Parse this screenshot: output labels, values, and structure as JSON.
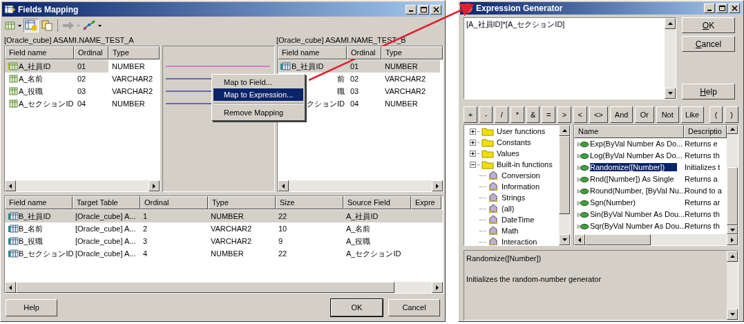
{
  "fields_mapping": {
    "title": "Fields Mapping",
    "source_label": "[Oracle_cube] ASAMI.NAME_TEST_A",
    "target_label": "[Oracle_cube] ASAMI.NAME_TEST_B",
    "source_table": {
      "columns": [
        "Field name",
        "Ordinal",
        "Type"
      ],
      "rows": [
        {
          "name": "A_社員ID",
          "ordinal": "01",
          "type": "NUMBER",
          "selected": true,
          "key": true
        },
        {
          "name": "A_名前",
          "ordinal": "02",
          "type": "VARCHAR2",
          "selected": false,
          "key": false
        },
        {
          "name": "A_役職",
          "ordinal": "03",
          "type": "VARCHAR2",
          "selected": false,
          "key": false
        },
        {
          "name": "A_セクションID",
          "ordinal": "04",
          "type": "NUMBER",
          "selected": false,
          "key": false
        }
      ]
    },
    "mapping_lines": [
      {
        "selected": true
      },
      {
        "selected": false
      },
      {
        "selected": false
      },
      {
        "selected": false
      }
    ],
    "context_menu": {
      "items": [
        {
          "kind": "item",
          "label": "Map to Field...",
          "selected": false
        },
        {
          "kind": "item",
          "label": "Map to Expression...",
          "selected": true
        },
        {
          "kind": "separator"
        },
        {
          "kind": "item",
          "label": "Remove Mapping",
          "selected": false
        }
      ]
    },
    "target_table": {
      "columns": [
        "Field name",
        "Ordinal",
        "Type"
      ],
      "rows": [
        {
          "name": "B_社員ID",
          "ordinal": "01",
          "type": "NUMBER",
          "selected": true,
          "covered": false
        },
        {
          "name": "前",
          "ordinal": "02",
          "type": "VARCHAR2",
          "selected": false,
          "covered": true
        },
        {
          "name": "職",
          "ordinal": "03",
          "type": "VARCHAR2",
          "selected": false,
          "covered": true
        },
        {
          "name": "クションID",
          "ordinal": "04",
          "type": "NUMBER",
          "selected": false,
          "covered": true
        }
      ]
    },
    "mappings_table": {
      "columns": [
        "Field name",
        "Target Table",
        "Ordinal",
        "Type",
        "Size",
        "Source Field",
        "Expre"
      ],
      "rows": [
        {
          "cells": [
            "B_社員ID",
            "[Oracle_cube] A...",
            "1",
            "NUMBER",
            "22",
            "A_社員ID"
          ],
          "selected": true
        },
        {
          "cells": [
            "B_名前",
            "[Oracle_cube] A...",
            "2",
            "VARCHAR2",
            "10",
            "A_名前"
          ],
          "selected": false
        },
        {
          "cells": [
            "B_役職",
            "[Oracle_cube] A...",
            "3",
            "VARCHAR2",
            "9",
            "A_役職"
          ],
          "selected": false
        },
        {
          "cells": [
            "B_セクションID",
            "[Oracle_cube] A...",
            "4",
            "NUMBER",
            "22",
            "A_セクションID"
          ],
          "selected": false
        }
      ]
    },
    "buttons": [
      {
        "label": "Help",
        "default": false
      },
      {
        "label": "OK",
        "default": true
      },
      {
        "label": "Cancel",
        "default": false
      }
    ]
  },
  "expression_generator": {
    "title": "Expression Generator",
    "expression": "[A_社員ID]*[A_セクションID]",
    "buttons": [
      {
        "hotkey": "O",
        "rest": "K"
      },
      {
        "hotkey": "C",
        "rest": "ancel"
      },
      {
        "hotkey": "H",
        "rest": "elp"
      }
    ],
    "operators": [
      "+",
      "-",
      "/",
      "*",
      "&",
      "=",
      ">",
      "<",
      "<>",
      "And",
      "Or",
      "Not",
      "Like",
      "(",
      ")"
    ],
    "tree": [
      {
        "label": "User functions",
        "expanded": false
      },
      {
        "label": "Constants",
        "expanded": false
      },
      {
        "label": "Values",
        "expanded": false
      },
      {
        "label": "Built-in functions",
        "expanded": true,
        "children": [
          {
            "label": "Conversion"
          },
          {
            "label": "Information"
          },
          {
            "label": "Strings"
          },
          {
            "label": "(all)"
          },
          {
            "label": "DateTime"
          },
          {
            "label": "Math"
          },
          {
            "label": "Interaction"
          }
        ]
      }
    ],
    "functions": {
      "columns": [
        "Name",
        "Descriptio"
      ],
      "rows": [
        {
          "name": "Exp(ByVal Number As Do...",
          "description": "Returns e",
          "selected": false
        },
        {
          "name": "Log(ByVal Number As Do...",
          "description": "Returns th",
          "selected": false
        },
        {
          "name": "Randomize([Number])",
          "description": "Initializes t",
          "selected": true
        },
        {
          "name": "Rnd([Number]) As Single",
          "description": "Returns a",
          "selected": false
        },
        {
          "name": "Round(Number, [ByVal Nu...",
          "description": "Round to a",
          "selected": false
        },
        {
          "name": "Sgn(Number)",
          "description": "Returns ar",
          "selected": false
        },
        {
          "name": "Sin(ByVal Number As Dou...",
          "description": "Returns th",
          "selected": false
        },
        {
          "name": "Sqr(ByVal Number As Dou...",
          "description": "Returns th",
          "selected": false
        }
      ]
    },
    "description": {
      "signature": "Randomize([Number])",
      "text": "Initializes the random-number generator"
    }
  }
}
